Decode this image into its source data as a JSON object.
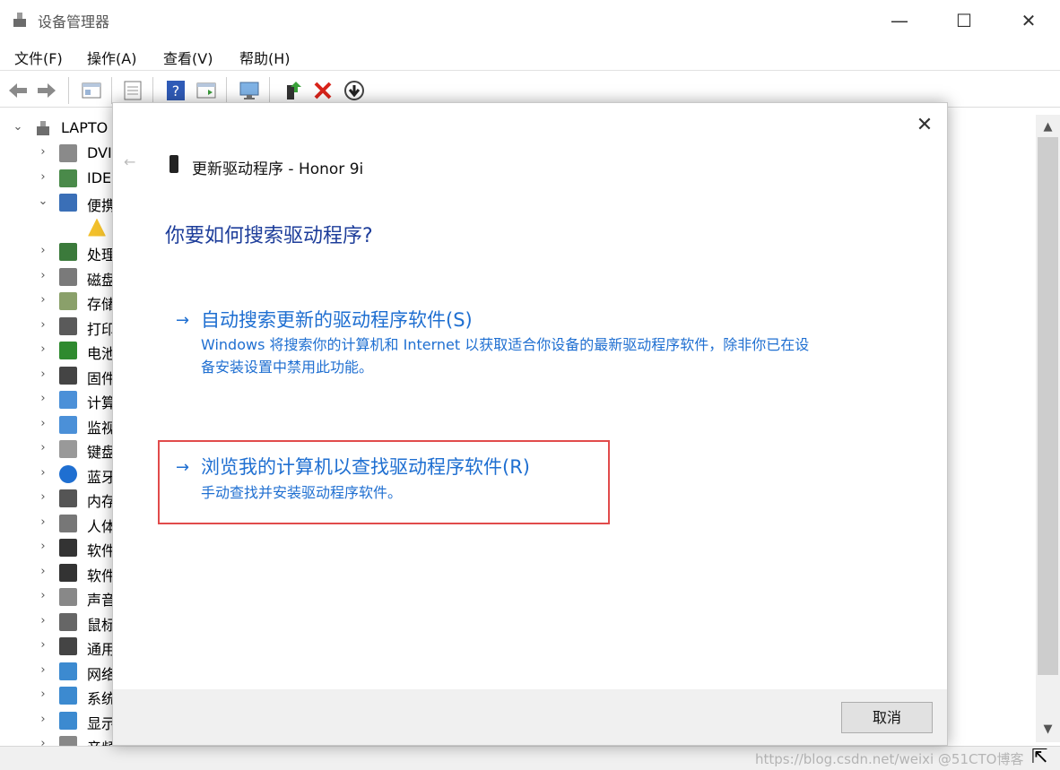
{
  "window": {
    "title": "设备管理器"
  },
  "menu": [
    "文件(F)",
    "操作(A)",
    "查看(V)",
    "帮助(H)"
  ],
  "toolbar": [
    "back-icon",
    "forward-icon",
    "properties-view-icon",
    "list-view-icon",
    "help-icon",
    "run-view-icon",
    "monitor-icon",
    "add-driver-icon",
    "uninstall-icon",
    "download-icon"
  ],
  "tree": {
    "root": "LAPTO",
    "items": [
      {
        "label": "DVI",
        "icon": "dvd-icon"
      },
      {
        "label": "IDE",
        "icon": "ide-icon"
      },
      {
        "label": "便携",
        "icon": "portable-device-icon"
      },
      {
        "label": "",
        "icon": "warning-icon"
      },
      {
        "label": "处理",
        "icon": "processor-icon"
      },
      {
        "label": "磁盘",
        "icon": "disk-icon"
      },
      {
        "label": "存储",
        "icon": "storage-icon"
      },
      {
        "label": "打印",
        "icon": "printer-icon"
      },
      {
        "label": "电池",
        "icon": "battery-icon"
      },
      {
        "label": "固件",
        "icon": "firmware-icon"
      },
      {
        "label": "计算",
        "icon": "computer-icon"
      },
      {
        "label": "监视",
        "icon": "monitor-icon"
      },
      {
        "label": "键盘",
        "icon": "keyboard-icon"
      },
      {
        "label": "蓝牙",
        "icon": "bluetooth-icon"
      },
      {
        "label": "内存",
        "icon": "memory-icon"
      },
      {
        "label": "人体",
        "icon": "hid-icon"
      },
      {
        "label": "软件",
        "icon": "software-icon"
      },
      {
        "label": "软件",
        "icon": "software-component-icon"
      },
      {
        "label": "声音",
        "icon": "sound-icon"
      },
      {
        "label": "鼠标",
        "icon": "mouse-icon"
      },
      {
        "label": "通用",
        "icon": "usb-icon"
      },
      {
        "label": "网络",
        "icon": "network-icon"
      },
      {
        "label": "系统",
        "icon": "system-icon"
      },
      {
        "label": "显示",
        "icon": "display-icon"
      },
      {
        "label": "音频",
        "icon": "audio-icon"
      }
    ]
  },
  "dialog": {
    "back_glyph": "←",
    "title": "更新驱动程序 - Honor 9i",
    "question": "你要如何搜索驱动程序?",
    "option1_title": "自动搜索更新的驱动程序软件(S)",
    "option1_desc": "Windows 将搜索你的计算机和 Internet 以获取适合你设备的最新驱动程序软件，除非你已在设备安装设置中禁用此功能。",
    "option2_title": "浏览我的计算机以查找驱动程序软件(R)",
    "option2_desc": "手动查找并安装驱动程序软件。",
    "cancel": "取消"
  },
  "watermark": "https://blog.csdn.net/weixi @51CTO博客",
  "colors": {
    "link": "#1f6fd1",
    "heading": "#1d3d9a",
    "highlight": "#e14b4b"
  }
}
